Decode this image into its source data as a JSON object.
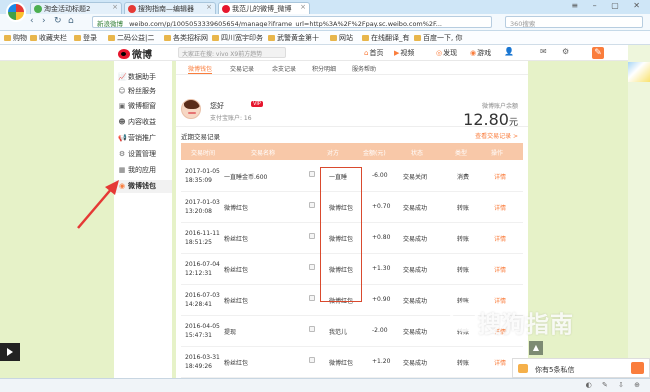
{
  "browser": {
    "tabs": [
      {
        "label": "淘金活动标题2"
      },
      {
        "label": "搜狗指南—编辑器"
      },
      {
        "label": "我范儿的微博_微博"
      }
    ],
    "secure_label": "新浪微博",
    "url": "weibo.com/p/1005053339605654/manage?iframe_url=http%3A%2F%2Fpay.sc.weibo.com%2F...",
    "search_placeholder": "360搜索",
    "bookmarks": [
      "购物",
      "收藏夹栏",
      "登录",
      "二码公益|二",
      "各类招标网",
      "四川宽宇印务",
      "武警黄金第十",
      "网站",
      "在线翻译_有",
      "百度一下, 你"
    ]
  },
  "weibo": {
    "logo_text": "微博",
    "search_placeholder": "大家正在搜: vivo X9前方趋势",
    "nav": {
      "home": "首页",
      "video": "视频",
      "discover": "发现",
      "game": "游戏"
    }
  },
  "sidebar": {
    "items": [
      {
        "label": "数据助手",
        "icon": "chart-icon"
      },
      {
        "label": "粉丝服务",
        "icon": "fans-icon"
      },
      {
        "label": "微博橱窗",
        "icon": "shop-icon"
      },
      {
        "label": "内容收益",
        "icon": "income-icon"
      },
      {
        "label": "营销推广",
        "icon": "megaphone-icon"
      },
      {
        "label": "设置管理",
        "icon": "settings-icon"
      },
      {
        "label": "我的应用",
        "icon": "apps-icon"
      },
      {
        "label": "微博钱包",
        "icon": "wallet-icon"
      }
    ]
  },
  "main": {
    "tabs": [
      "微博钱包",
      "交易记录",
      "余支记录",
      "积分明细",
      "服务帮助"
    ],
    "user": {
      "greeting": "您好",
      "vip": "VIP",
      "account_label": "支付宝账户: 16"
    },
    "balance_label": "微博账户余额",
    "balance": "12.80",
    "balance_unit": "元",
    "records_title": "近期交易记录",
    "records_more": "查看交易记录 >",
    "table": {
      "headers": [
        "交易时间",
        "交易名称",
        "对方",
        "金额(元)",
        "状态",
        "类型",
        "操作"
      ],
      "rows": [
        {
          "date": "2017-01-05",
          "time": "18:35:09",
          "desc": "一直睡金币.600",
          "name": "一直睡",
          "amount": "-6.00",
          "status": "交易关闭",
          "type": "消费",
          "link": "详情"
        },
        {
          "date": "2017-01-03",
          "time": "13:20:08",
          "desc": "微博红包",
          "name": "微博红包",
          "amount": "+0.70",
          "status": "交易成功",
          "type": "转账",
          "link": "详情"
        },
        {
          "date": "2016-11-11",
          "time": "18:51:25",
          "desc": "粉丝红包",
          "name": "微博红包",
          "amount": "+0.80",
          "status": "交易成功",
          "type": "转账",
          "link": "详情"
        },
        {
          "date": "2016-07-04",
          "time": "12:12:31",
          "desc": "粉丝红包",
          "name": "微博红包",
          "amount": "+1.30",
          "status": "交易成功",
          "type": "转账",
          "link": "详情"
        },
        {
          "date": "2016-07-03",
          "time": "14:28:41",
          "desc": "粉丝红包",
          "name": "微博红包",
          "amount": "+0.90",
          "status": "交易成功",
          "type": "转账",
          "link": "详情"
        },
        {
          "date": "2016-04-05",
          "time": "15:47:31",
          "desc": "提现",
          "name": "我范儿",
          "amount": "-2.00",
          "status": "交易成功",
          "type": "转账",
          "link": "详情"
        },
        {
          "date": "2016-03-31",
          "time": "18:49:26",
          "desc": "粉丝红包",
          "name": "微博红包",
          "amount": "+1.20",
          "status": "交易成功",
          "type": "转账",
          "link": "详情"
        }
      ]
    }
  },
  "overlays": {
    "watermark": "搜狗指南",
    "message_bar": "你有5条私信"
  },
  "colors": {
    "accent": "#fa7d3c",
    "highlight": "#d94a2e",
    "table_header": "#f8c8a8"
  }
}
